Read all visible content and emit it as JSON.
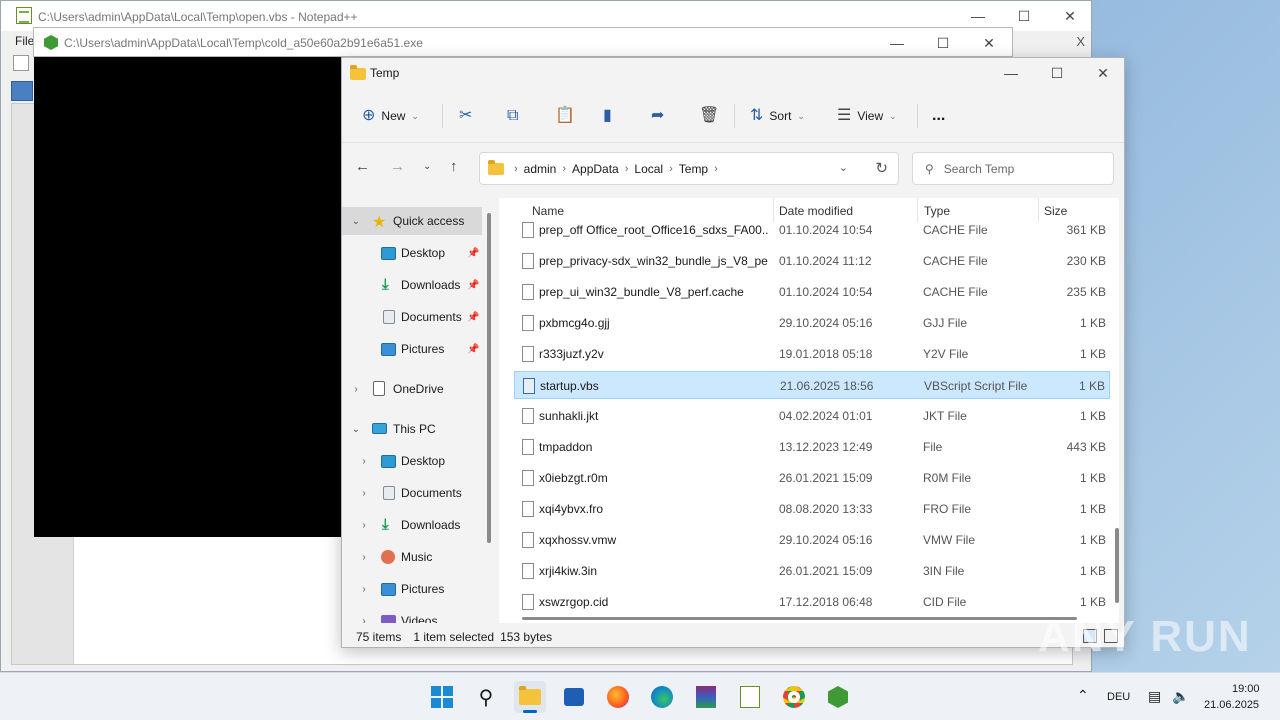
{
  "notepad": {
    "title": "C:\\Users\\admin\\AppData\\Local\\Temp\\open.vbs - Notepad++",
    "menu_file": "File",
    "close_x": "X"
  },
  "cold_window": {
    "title": "C:\\Users\\admin\\AppData\\Local\\Temp\\cold_a50e60a2b91e6a51.exe"
  },
  "explorer": {
    "title": "Temp",
    "toolbar": {
      "new_label": "New",
      "sort_label": "Sort",
      "view_label": "View",
      "more_label": "..."
    },
    "address": [
      "admin",
      "AppData",
      "Local",
      "Temp"
    ],
    "search_placeholder": "Search Temp",
    "nav": {
      "quick_access": "Quick access",
      "qa_items": [
        "Desktop",
        "Downloads",
        "Documents",
        "Pictures"
      ],
      "onedrive": "OneDrive",
      "this_pc": "This PC",
      "pc_items": [
        "Desktop",
        "Documents",
        "Downloads",
        "Music",
        "Pictures",
        "Videos"
      ]
    },
    "columns": {
      "name": "Name",
      "date": "Date modified",
      "type": "Type",
      "size": "Size"
    },
    "files": [
      {
        "name": "prep_off Office_root_Office16_sdxs_FA00...",
        "date": "01.10.2024 10:54",
        "type": "CACHE File",
        "size": "361 KB"
      },
      {
        "name": "prep_privacy-sdx_win32_bundle_js_V8_pe...",
        "date": "01.10.2024 11:12",
        "type": "CACHE File",
        "size": "230 KB"
      },
      {
        "name": "prep_ui_win32_bundle_V8_perf.cache",
        "date": "01.10.2024 10:54",
        "type": "CACHE File",
        "size": "235 KB"
      },
      {
        "name": "pxbmcg4o.gjj",
        "date": "29.10.2024 05:16",
        "type": "GJJ File",
        "size": "1 KB"
      },
      {
        "name": "r333juzf.y2v",
        "date": "19.01.2018 05:18",
        "type": "Y2V File",
        "size": "1 KB"
      },
      {
        "name": "startup.vbs",
        "date": "21.06.2025 18:56",
        "type": "VBScript Script File",
        "size": "1 KB",
        "selected": true
      },
      {
        "name": "sunhakli.jkt",
        "date": "04.02.2024 01:01",
        "type": "JKT File",
        "size": "1 KB"
      },
      {
        "name": "tmpaddon",
        "date": "13.12.2023 12:49",
        "type": "File",
        "size": "443 KB"
      },
      {
        "name": "x0iebzgt.r0m",
        "date": "26.01.2021 15:09",
        "type": "R0M File",
        "size": "1 KB"
      },
      {
        "name": "xqi4ybvx.fro",
        "date": "08.08.2020 13:33",
        "type": "FRO File",
        "size": "1 KB"
      },
      {
        "name": "xqxhossv.vmw",
        "date": "29.10.2024 05:16",
        "type": "VMW File",
        "size": "1 KB"
      },
      {
        "name": "xrji4kiw.3in",
        "date": "26.01.2021 15:09",
        "type": "3IN File",
        "size": "1 KB"
      },
      {
        "name": "xswzrgop.cid",
        "date": "17.12.2018 06:48",
        "type": "CID File",
        "size": "1 KB"
      }
    ],
    "status": {
      "items": "75 items",
      "selected": "1 item selected",
      "bytes": "153 bytes"
    }
  },
  "watermark": "ANY RUN",
  "taskbar": {
    "language": "DEU",
    "time": "19:00",
    "date": "21.06.2025"
  },
  "colors": {
    "accent": "#0067c0",
    "selection": "#cce8ff"
  }
}
